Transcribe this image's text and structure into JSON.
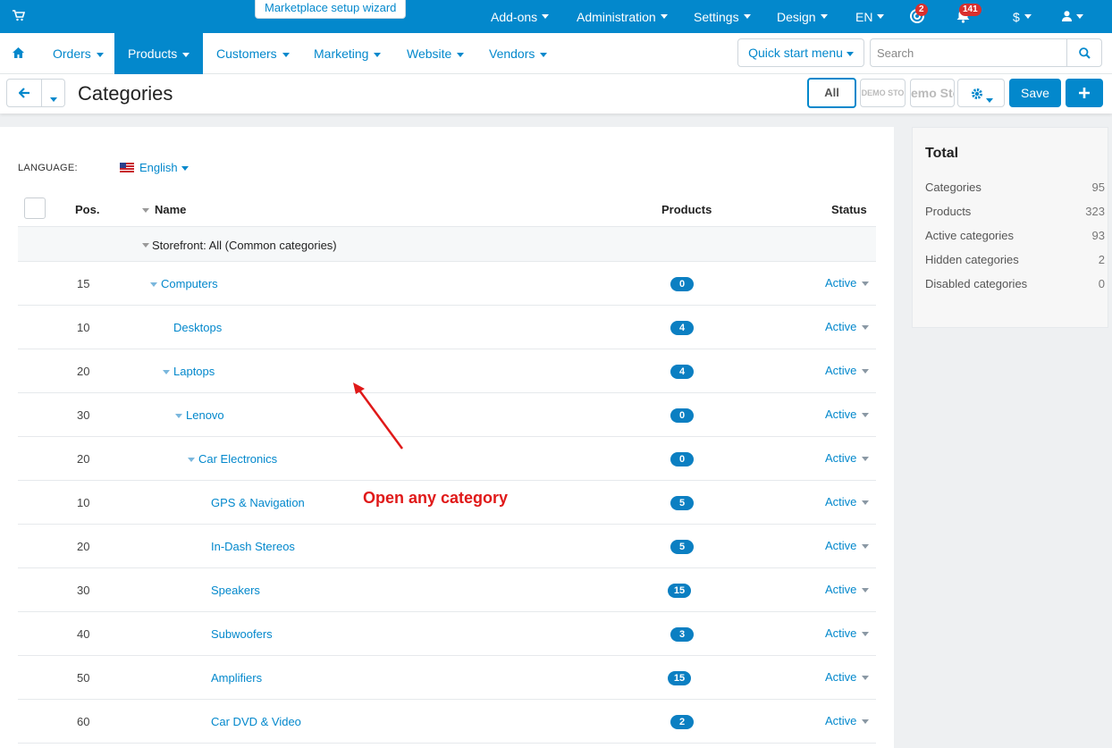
{
  "topbar": {
    "wizard_label": "Marketplace setup wizard",
    "items": [
      {
        "label": "Add-ons"
      },
      {
        "label": "Administration"
      },
      {
        "label": "Settings"
      },
      {
        "label": "Design"
      },
      {
        "label": "EN"
      }
    ],
    "help_badge": "2",
    "notifications_badge": "141",
    "currency": "$"
  },
  "nav": {
    "items": [
      "Orders",
      "Products",
      "Customers",
      "Marketing",
      "Website",
      "Vendors"
    ],
    "active": "Products",
    "quick_start_label": "Quick start menu",
    "search_placeholder": "Search"
  },
  "titlebar": {
    "title": "Categories",
    "all_label": "All",
    "demo1": "DEMO STO",
    "demo2": "emo Sto",
    "save_label": "Save"
  },
  "language": {
    "label": "LANGUAGE:",
    "value": "English"
  },
  "table": {
    "headers": {
      "pos": "Pos.",
      "name": "Name",
      "products": "Products",
      "status": "Status"
    },
    "storefront": "Storefront: All (Common categories)",
    "rows": [
      {
        "pos": "15",
        "name": "Computers",
        "products": "0",
        "status": "Active"
      },
      {
        "pos": "10",
        "name": "Desktops",
        "products": "4",
        "status": "Active"
      },
      {
        "pos": "20",
        "name": "Laptops",
        "products": "4",
        "status": "Active"
      },
      {
        "pos": "30",
        "name": "Lenovo",
        "products": "0",
        "status": "Active"
      },
      {
        "pos": "20",
        "name": "Car Electronics",
        "products": "0",
        "status": "Active"
      },
      {
        "pos": "10",
        "name": "GPS & Navigation",
        "products": "5",
        "status": "Active"
      },
      {
        "pos": "20",
        "name": "In-Dash Stereos",
        "products": "5",
        "status": "Active"
      },
      {
        "pos": "30",
        "name": "Speakers",
        "products": "15",
        "status": "Active"
      },
      {
        "pos": "40",
        "name": "Subwoofers",
        "products": "3",
        "status": "Active"
      },
      {
        "pos": "50",
        "name": "Amplifiers",
        "products": "15",
        "status": "Active"
      },
      {
        "pos": "60",
        "name": "Car DVD & Video",
        "products": "2",
        "status": "Active"
      }
    ]
  },
  "totals": {
    "title": "Total",
    "rows": [
      {
        "label": "Categories",
        "value": "95"
      },
      {
        "label": "Products",
        "value": "323"
      },
      {
        "label": "Active categories",
        "value": "93"
      },
      {
        "label": "Hidden categories",
        "value": "2"
      },
      {
        "label": "Disabled categories",
        "value": "0"
      }
    ]
  },
  "annotation": "Open any category",
  "colors": {
    "accent": "#0388cc",
    "badge_red": "#d9302e",
    "annotation_red": "#e01919"
  }
}
